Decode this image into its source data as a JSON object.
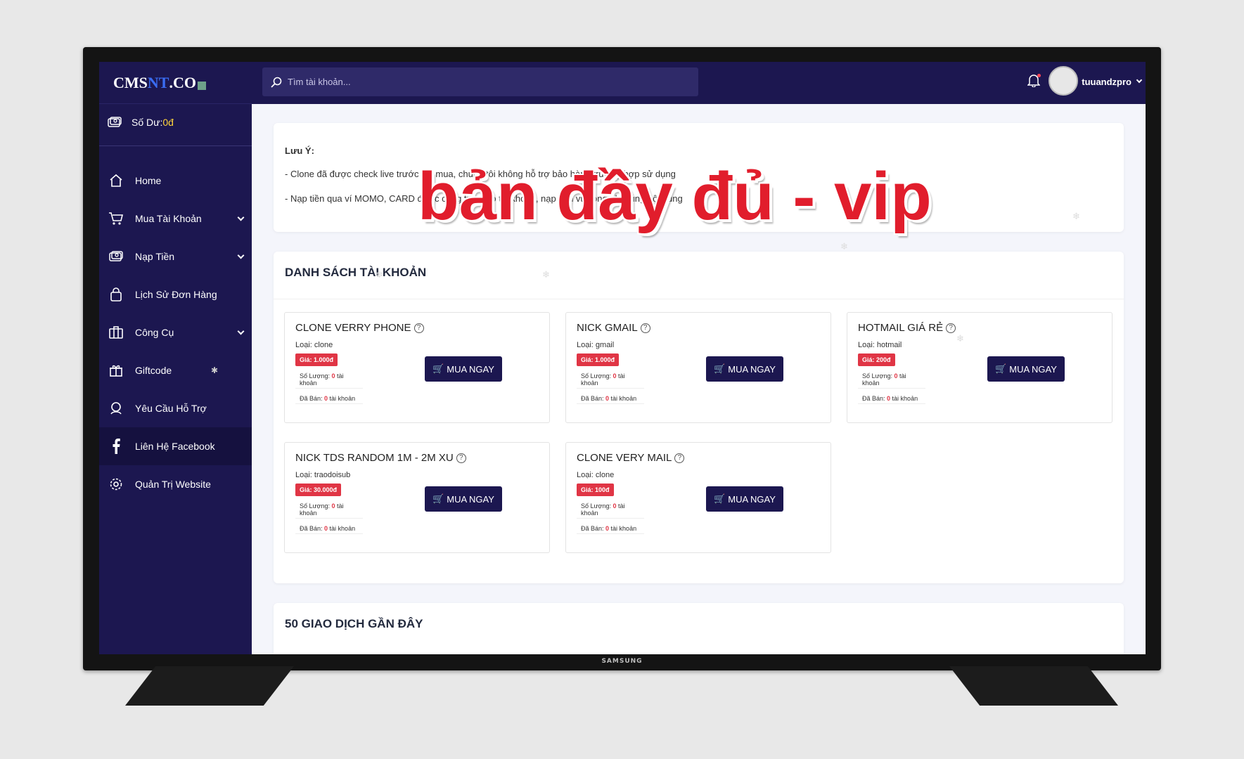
{
  "brand": {
    "pre": "CMS",
    "mid": "NT",
    "post": ".CO"
  },
  "search": {
    "placeholder": "Tìm tài khoản..."
  },
  "user": {
    "name": "tuuandzpro"
  },
  "balance": {
    "label": "Số Dư: ",
    "value": "0đ"
  },
  "menu": [
    {
      "label": "Home"
    },
    {
      "label": "Mua Tài Khoản"
    },
    {
      "label": "Nạp Tiền"
    },
    {
      "label": "Lịch Sử Đơn Hàng"
    },
    {
      "label": "Công Cụ"
    },
    {
      "label": "Giftcode"
    },
    {
      "label": "Yêu Cầu Hỗ Trợ"
    },
    {
      "label": "Liên Hệ Facebook"
    },
    {
      "label": "Quản Trị Website"
    }
  ],
  "notice": {
    "title": "Lưu Ý:",
    "line1": "- Clone đã được check live trước khi mua, chúng tôi không hỗ trợ bảo hành trường hợp sử dụng",
    "line2": "- Nạp tiền qua ví MOMO, CARD được cộng tiền vào tài khoản, nạp tiền vui lòng ghi đúng nội dung"
  },
  "accounts": {
    "heading": "DANH SÁCH TÀI KHOẢN",
    "buy_label": "MUA NGAY",
    "items": [
      {
        "name": "CLONE VERRY PHONE",
        "type": "Loại: clone",
        "price": "Giá: 1.000đ",
        "qty_label": "Số Lượng: ",
        "qty": "0",
        "sold_label": "Đã Bán: ",
        "sold": "0",
        "unit": " tài khoản"
      },
      {
        "name": "NICK GMAIL",
        "type": "Loại: gmail",
        "price": "Giá: 1.000đ",
        "qty_label": "Số Lượng: ",
        "qty": "0",
        "sold_label": "Đã Bán: ",
        "sold": "0",
        "unit": " tài khoản"
      },
      {
        "name": "HOTMAIL GIÁ RẺ",
        "type": "Loại: hotmail",
        "price": "Giá: 200đ",
        "qty_label": "Số Lượng: ",
        "qty": "0",
        "sold_label": "Đã Bán: ",
        "sold": "0",
        "unit": " tài khoản"
      },
      {
        "name": "NICK TDS RANDOM 1M - 2M XU",
        "type": "Loại: traodoisub",
        "price": "Giá: 30.000đ",
        "qty_label": "Số Lượng: ",
        "qty": "0",
        "sold_label": "Đã Bán: ",
        "sold": "0",
        "unit": " tài khoản"
      },
      {
        "name": "CLONE VERY MAIL",
        "type": "Loại: clone",
        "price": "Giá: 100đ",
        "qty_label": "Số Lượng: ",
        "qty": "0",
        "sold_label": "Đã Bán: ",
        "sold": "0",
        "unit": " tài khoản"
      }
    ]
  },
  "recent": {
    "heading": "50 GIAO DỊCH GẦN ĐÂY"
  },
  "overlay": {
    "text": "bản đầy đủ - vip"
  },
  "tv": {
    "brand": "SAMSUNG"
  },
  "colors": {
    "sidebar": "#1c1750",
    "accent": "#3a6cf2",
    "price": "#e03545",
    "watermark": "#e11d2c"
  }
}
